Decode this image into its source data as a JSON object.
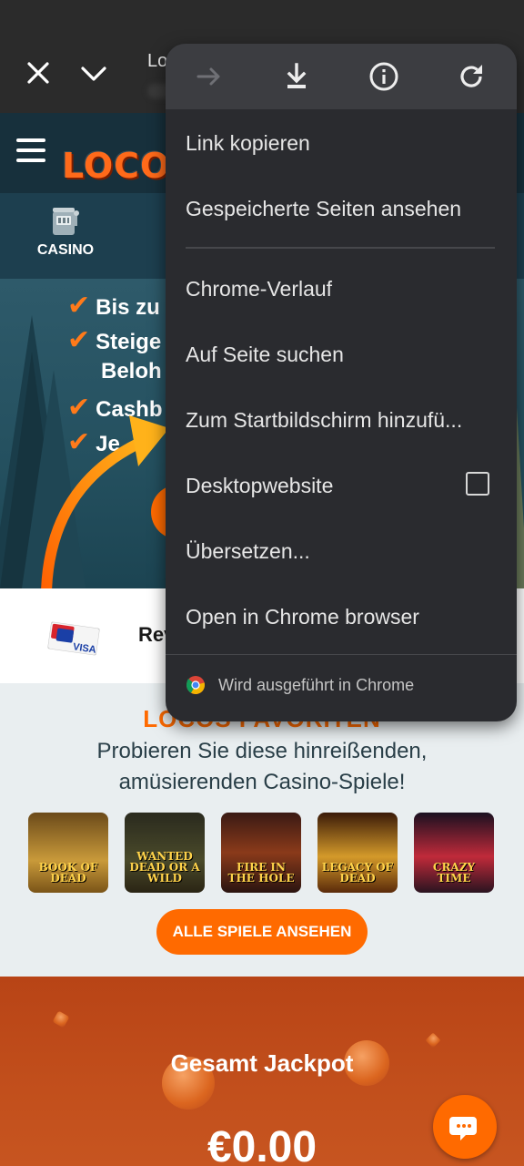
{
  "browser": {
    "title_partial": "Lo"
  },
  "menu": {
    "icons": [
      "forward-arrow-icon",
      "download-icon",
      "info-icon",
      "reload-icon"
    ],
    "items": [
      {
        "label": "Link kopieren"
      },
      {
        "label": "Gespeicherte Seiten ansehen"
      },
      {
        "label": "Chrome-Verlauf"
      },
      {
        "label": "Auf Seite suchen"
      },
      {
        "label": "Zum Startbildschirm hinzufü..."
      },
      {
        "label": "Desktopwebsite",
        "checked": false
      },
      {
        "label": "Übersetzen..."
      },
      {
        "label": "Open in Chrome browser"
      }
    ],
    "footer": "Wird ausgeführt in Chrome"
  },
  "site": {
    "logo": "LOCO",
    "nav": {
      "casino_label": "CASINO"
    },
    "hero": {
      "features": [
        "Bis zu",
        "Steige",
        "Beloh",
        "Cashb",
        "Je"
      ]
    },
    "payments": {
      "visa": "VISA",
      "rev": "Rev"
    },
    "favorites": {
      "title": "LOCOS FAVORITEN",
      "subtitle_line1": "Probieren Sie diese hinreißenden,",
      "subtitle_line2": "amüsierenden Casino-Spiele!",
      "games": [
        "BOOK OF DEAD",
        "WANTED DEAD OR A WILD",
        "FIRE IN THE HOLE",
        "LEGACY OF DEAD",
        "CRAZY TIME"
      ],
      "button": "ALLE SPIELE ANSEHEN"
    },
    "jackpot": {
      "title": "Gesamt Jackpot",
      "value": "€0.00"
    }
  },
  "colors": {
    "accent": "#ff6a00",
    "menu_bg": "#2a2b2f",
    "header_bg": "#17303c"
  }
}
